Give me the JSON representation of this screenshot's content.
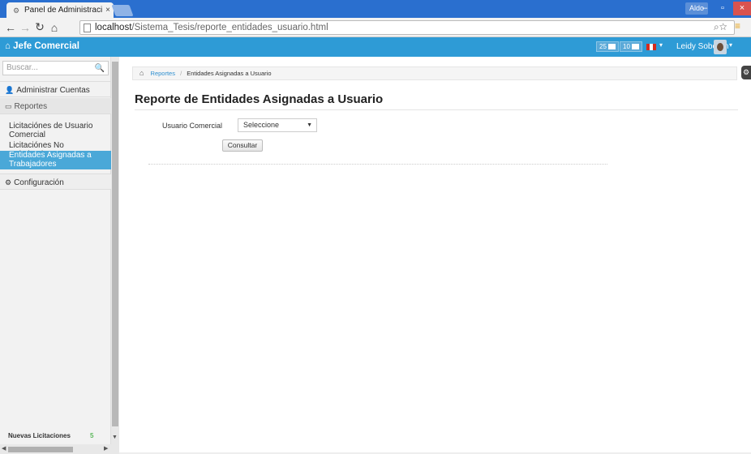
{
  "browser": {
    "tab_title": "Panel de Administración",
    "tab_close": "×",
    "window_user": "Aldo",
    "url_host": "localhost",
    "url_path": "/Sistema_Tesis/reporte_entidades_usuario.html"
  },
  "header": {
    "brand": "Jefe Comercial",
    "badge1_count": "25",
    "badge2_count": "10",
    "user_name": "Leidy Soberón"
  },
  "sidebar": {
    "search_placeholder": "Buscar...",
    "sections": {
      "accounts": "Administrar Cuentas",
      "reports": "Reportes",
      "config": "Configuración"
    },
    "report_items": [
      "Licitaciónes de Usuario Comercial",
      "Licitaciónes No Culminadas",
      "Entidades Asignadas a Trabajadores"
    ],
    "footer_label": "Nuevas Licitaciones",
    "footer_count": "5"
  },
  "breadcrumb": {
    "parent": "Reportes",
    "current": "Entidades Asignadas a Usuario"
  },
  "main": {
    "title": "Reporte de Entidades Asignadas a Usuario",
    "field_label": "Usuario Comercial",
    "select_value": "Seleccione",
    "button_label": "Consultar"
  },
  "colors": {
    "header_bg": "#2e9bd6",
    "active_item": "#4aa8d8",
    "tabbar": "#2a6fcf"
  }
}
